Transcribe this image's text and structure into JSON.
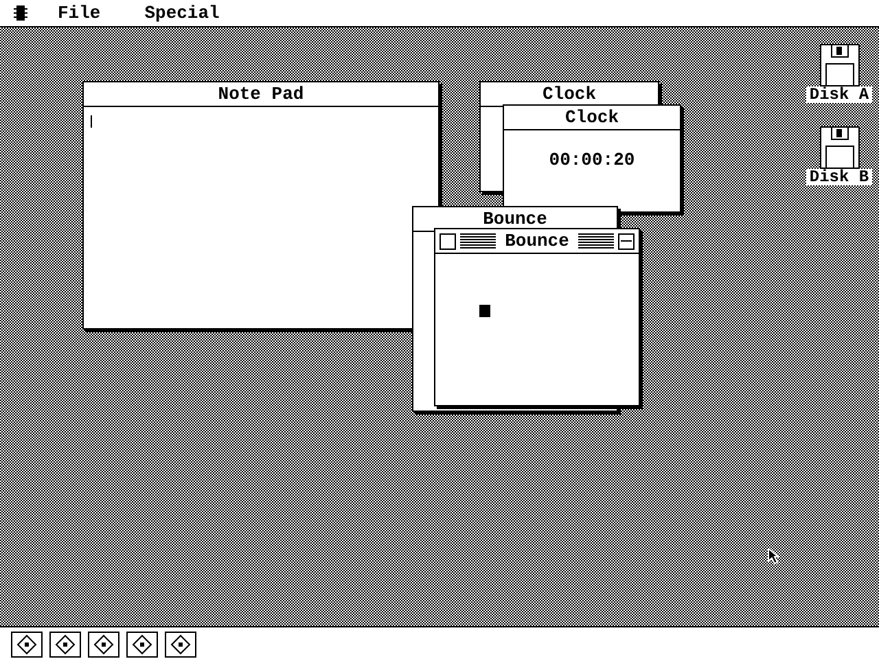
{
  "menu_bar": {
    "menus": [
      "File",
      "Special"
    ]
  },
  "windows": [
    {
      "title": "Note Pad",
      "kind": "notepad",
      "active": false
    },
    {
      "title": "Clock",
      "kind": "blank",
      "active": false
    },
    {
      "title": "Clock",
      "kind": "clock",
      "active": false,
      "time": "00:00:20"
    },
    {
      "title": "Bounce",
      "kind": "blank",
      "active": false
    },
    {
      "title": "Bounce",
      "kind": "bounce",
      "active": true
    }
  ],
  "disks": [
    {
      "label": "Disk A"
    },
    {
      "label": "Disk B"
    }
  ]
}
